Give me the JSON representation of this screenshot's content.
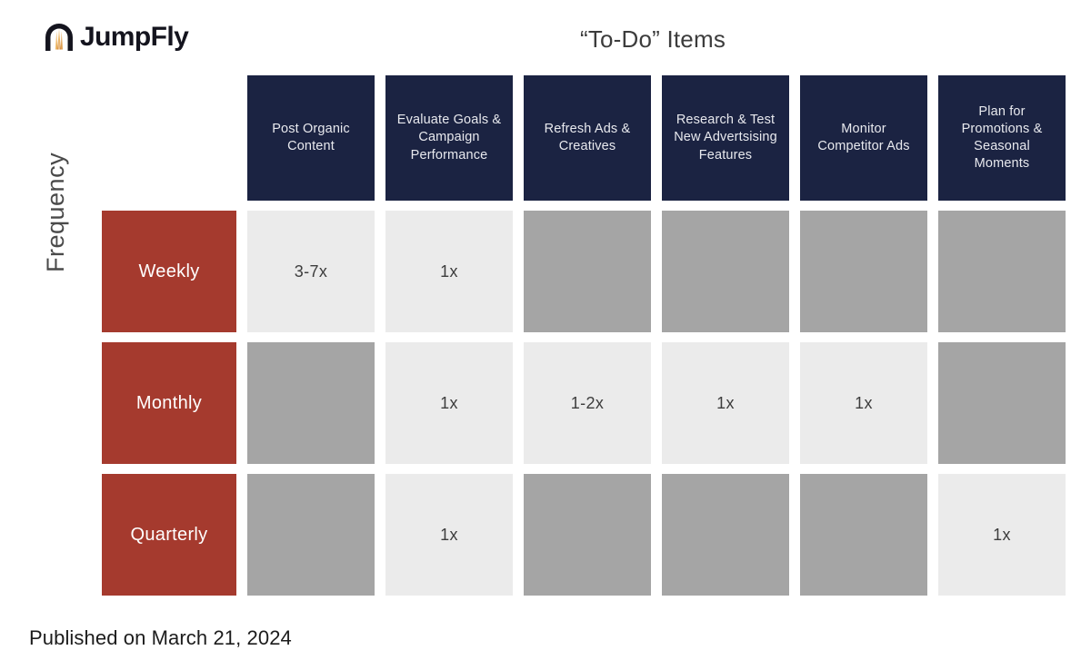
{
  "brand": {
    "name": "JumpFly",
    "logo_icon": "jumpfly-arch-logo-icon",
    "logo_dark": "#14141e",
    "logo_accent": "#e8a33d"
  },
  "header": {
    "title": "“To-Do” Items"
  },
  "axis": {
    "y_label": "Frequency"
  },
  "footer": {
    "published": "Published on March 21, 2024"
  },
  "colors": {
    "header_navy": "#1b2342",
    "row_red": "#a53a2e",
    "cell_light": "#ebebeb",
    "cell_shaded": "#a5a5a5",
    "page_background": "#ffffff"
  },
  "chart_data": {
    "type": "heatmap",
    "title": "“To-Do” Items",
    "xlabel": "“To-Do” Items",
    "ylabel": "Frequency",
    "grid": false,
    "legend": "none",
    "categories": [
      "Post Organic Content",
      "Evaluate Goals & Campaign Performance",
      "Refresh Ads & Creatives",
      "Research & Test New Advertsising Features",
      "Monitor Competitor Ads",
      "Plan for Promotions & Seasonal Moments"
    ],
    "rows": [
      "Weekly",
      "Monthly",
      "Quarterly"
    ],
    "cells": [
      [
        {
          "value": "3-7x",
          "state": "light"
        },
        {
          "value": "1x",
          "state": "light"
        },
        {
          "value": "",
          "state": "shaded"
        },
        {
          "value": "",
          "state": "shaded"
        },
        {
          "value": "",
          "state": "shaded"
        },
        {
          "value": "",
          "state": "shaded"
        }
      ],
      [
        {
          "value": "",
          "state": "shaded"
        },
        {
          "value": "1x",
          "state": "light"
        },
        {
          "value": "1-2x",
          "state": "light"
        },
        {
          "value": "1x",
          "state": "light"
        },
        {
          "value": "1x",
          "state": "light"
        },
        {
          "value": "",
          "state": "shaded"
        }
      ],
      [
        {
          "value": "",
          "state": "shaded"
        },
        {
          "value": "1x",
          "state": "light"
        },
        {
          "value": "",
          "state": "shaded"
        },
        {
          "value": "",
          "state": "shaded"
        },
        {
          "value": "",
          "state": "shaded"
        },
        {
          "value": "1x",
          "state": "light"
        }
      ]
    ]
  }
}
